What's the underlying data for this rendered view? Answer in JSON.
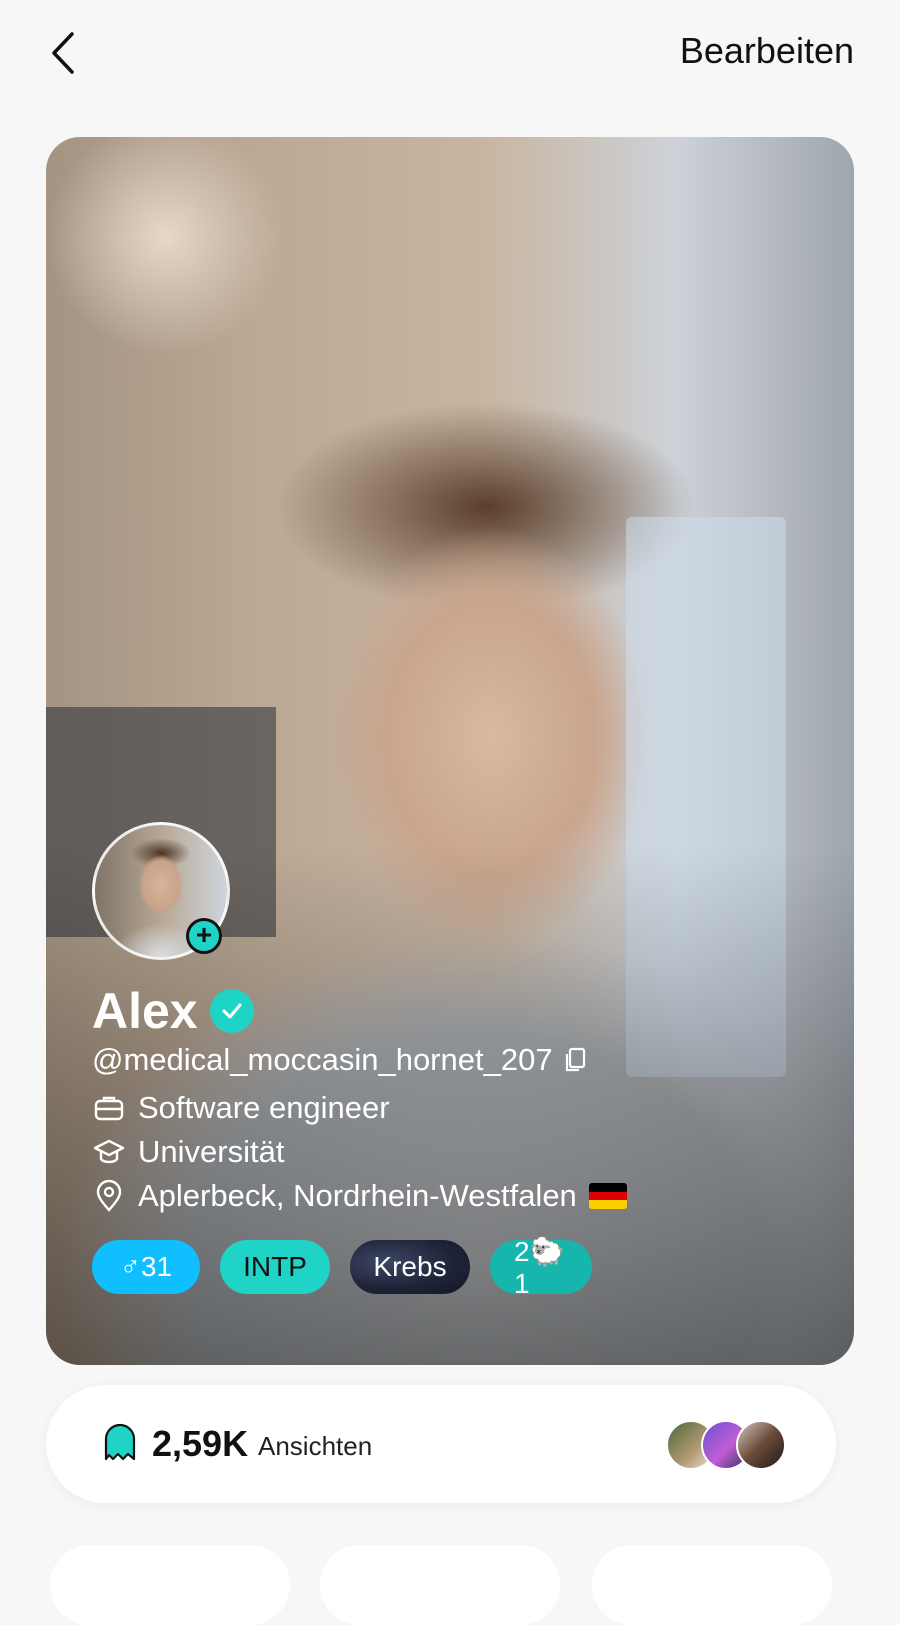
{
  "header": {
    "back_icon": "chevron-left-icon",
    "edit_label": "Bearbeiten"
  },
  "profile": {
    "name": "Alex",
    "verified_icon": "check-badge-icon",
    "username": "@medical_moccasin_hornet_207",
    "job": "Software engineer",
    "education": "Universität",
    "location": "Aplerbeck, Nordrhein-Westfalen",
    "flag": "DE",
    "tags": {
      "gender": "♂31",
      "mbti": "INTP",
      "zodiac": "Krebs",
      "kids": "2🐑1"
    }
  },
  "views": {
    "count": "2,59K",
    "label": "Ansichten"
  },
  "colors": {
    "accent": "#1fd3c7",
    "gender_tag": "#0fbfff",
    "kids_tag": "#17b6ad"
  }
}
